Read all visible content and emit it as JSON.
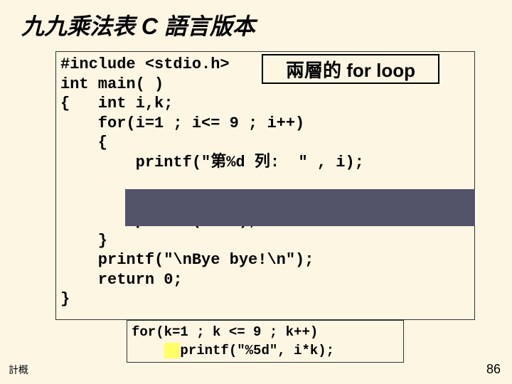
{
  "title": "九九乘法表 C 語言版本",
  "annotation": "兩層的 for loop",
  "code_lines": {
    "l1": "#include <stdio.h>",
    "l2": "int main( )",
    "l3": "{   int i,k;",
    "l4": "    for(i=1 ; i<= 9 ; i++)",
    "l5": "    {",
    "l6": "        printf(\"第%d 列:  \" , i);",
    "l7": "",
    "l8": "",
    "l9": "        printf(\"\\n\");",
    "l10": "    }",
    "l11": "    printf(\"\\nBye bye!\\n\");",
    "l12": "    return 0;",
    "l13": "}"
  },
  "answer": {
    "a1": "for(k=1 ; k <= 9 ; k++)",
    "a2_prefix": "    ",
    "a2_hl": "  ",
    "a2_rest": "printf(\"%5d\", i*k);"
  },
  "footer_left": "計概",
  "footer_right": "86"
}
